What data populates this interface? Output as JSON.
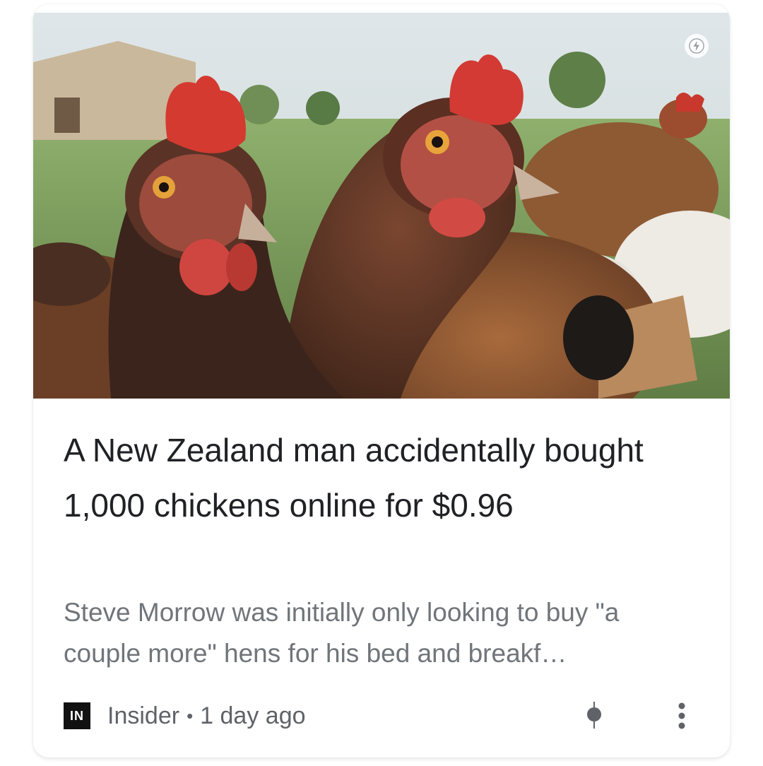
{
  "card": {
    "headline": "A New Zealand man accidentally bought 1,000 chickens online for $0.96",
    "snippet": "Steve Morrow was initially only looking to buy \"a couple more\" hens for his bed and breakf…",
    "source": {
      "logo_text": "IN",
      "name": "Insider",
      "separator": "•",
      "time": "1 day ago"
    },
    "image": {
      "subject": "chickens"
    },
    "icons": {
      "amp": "amp-lightning-icon",
      "save": "save-pin-icon",
      "more": "more-vert-icon"
    }
  }
}
